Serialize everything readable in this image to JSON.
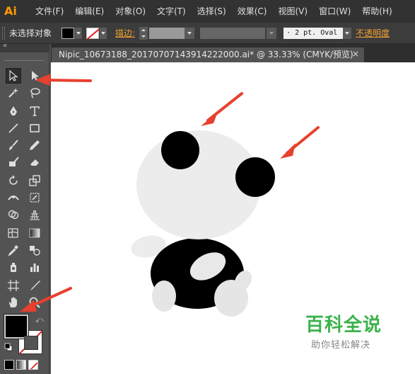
{
  "app": {
    "logo": "Ai"
  },
  "menubar": {
    "items": [
      "文件(F)",
      "编辑(E)",
      "对象(O)",
      "文字(T)",
      "选择(S)",
      "效果(C)",
      "视图(V)",
      "窗口(W)",
      "帮助(H)"
    ]
  },
  "controlbar": {
    "selection_label": "未选择对象",
    "stroke_label": "描边:",
    "brush_value": "· 2 pt. Oval",
    "opacity_label": "不透明度"
  },
  "document": {
    "tab_title": "Nipic_10673188_20170707143914222000.ai*  @  33.33% (CMYK/预览)",
    "close_glyph": "×"
  },
  "watermark": {
    "title": "百科全说",
    "subtitle": "助你轻松解决"
  },
  "colors": {
    "accent_orange": "#ff9a00",
    "arrow_red": "#e8402e",
    "panda_black": "#000000",
    "panda_grey": "#ececec",
    "watermark_green": "#3bb24a"
  }
}
